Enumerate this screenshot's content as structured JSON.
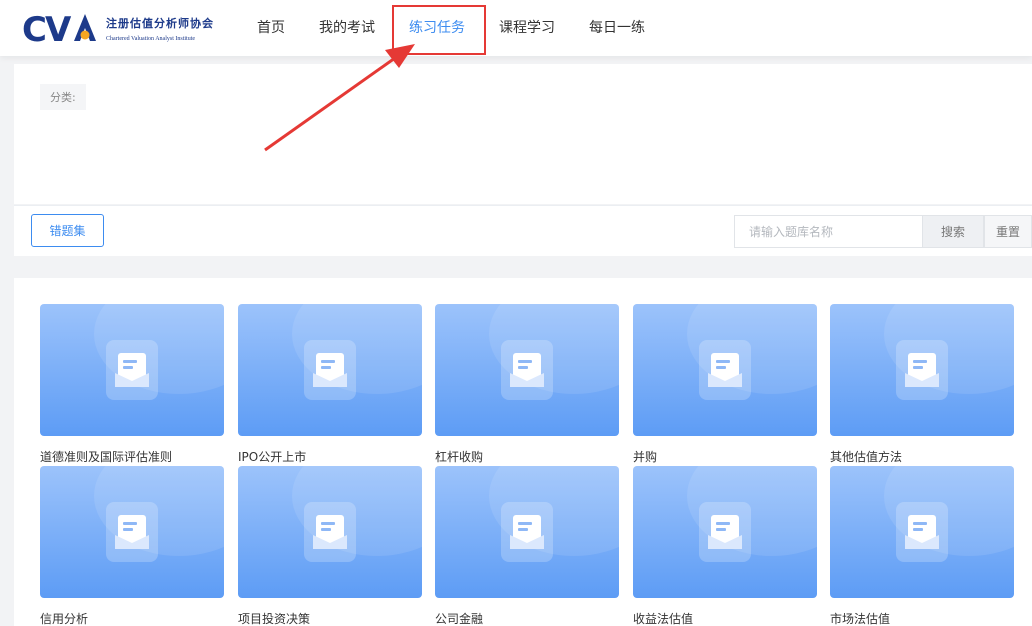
{
  "header": {
    "logo": {
      "mark": "CVA",
      "name_cn": "注册估值分析师协会",
      "name_en": "Chartered Valuation Analyst Institute"
    },
    "nav": [
      {
        "label": "首页",
        "active": false
      },
      {
        "label": "我的考试",
        "active": false
      },
      {
        "label": "练习任务",
        "active": true
      },
      {
        "label": "课程学习",
        "active": false
      },
      {
        "label": "每日一练",
        "active": false
      }
    ]
  },
  "filter": {
    "category_label": "分类:"
  },
  "toolbar": {
    "wrong_set_label": "错题集",
    "search_placeholder": "请输入题库名称",
    "search_value": "",
    "search_button": "搜索",
    "reset_button": "重置"
  },
  "cards": [
    {
      "title": "道德准则及国际评估准则"
    },
    {
      "title": "IPO公开上市"
    },
    {
      "title": "杠杆收购"
    },
    {
      "title": "并购"
    },
    {
      "title": "其他估值方法"
    },
    {
      "title": "信用分析"
    },
    {
      "title": "项目投资决策"
    },
    {
      "title": "公司金融"
    },
    {
      "title": "收益法估值"
    },
    {
      "title": "市场法估值"
    }
  ],
  "colors": {
    "accent": "#3d8cf0",
    "highlight_box": "#e53935",
    "arrow": "#e53935",
    "card_gradient_top": "#9cc3fb",
    "card_gradient_bottom": "#5d9cf5",
    "logo_blue": "#1d3a8a",
    "logo_orange": "#f5a623"
  }
}
